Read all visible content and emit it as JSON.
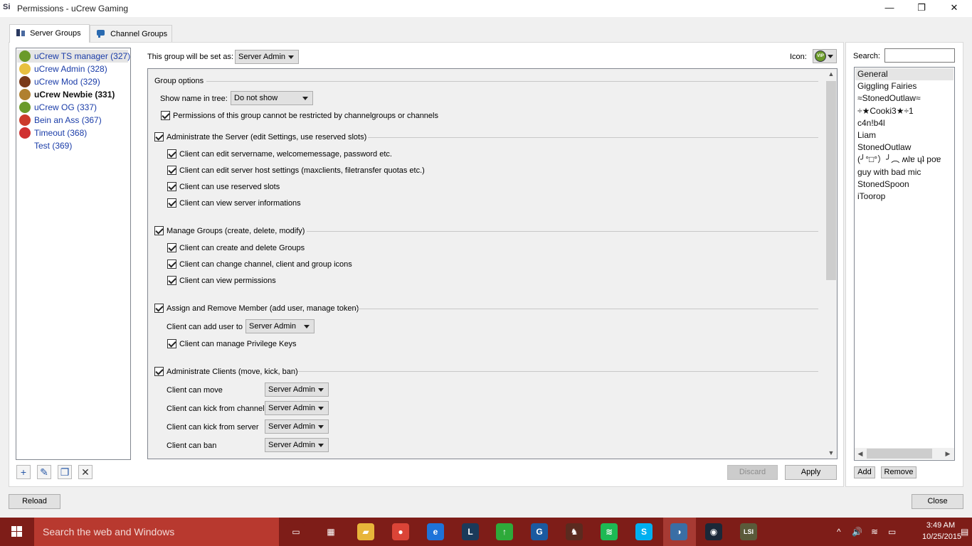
{
  "window": {
    "title": "Permissions - uCrew Gaming",
    "app_icon_text": "Si",
    "minimize_glyph": "—",
    "restore_glyph": "❐",
    "close_glyph": "✕"
  },
  "tabs": [
    {
      "label": "Server Groups",
      "active": true
    },
    {
      "label": "Channel Groups",
      "active": false
    }
  ],
  "groups": [
    {
      "label": "uCrew TS manager (327)",
      "icon": "vip-icon",
      "selected": true,
      "bold": false
    },
    {
      "label": "uCrew Admin (328)",
      "icon": "crown-icon",
      "selected": false,
      "bold": false
    },
    {
      "label": "uCrew Mod (329)",
      "icon": "mod-icon",
      "selected": false,
      "bold": false
    },
    {
      "label": "uCrew Newbie (331)",
      "icon": "newbie-icon",
      "selected": false,
      "bold": true
    },
    {
      "label": "uCrew OG (337)",
      "icon": "vip-icon",
      "selected": false,
      "bold": false
    },
    {
      "label": "Bein an Ass (367)",
      "icon": "ass-icon",
      "selected": false,
      "bold": false
    },
    {
      "label": "Timeout (368)",
      "icon": "timeout-icon",
      "selected": false,
      "bold": false
    },
    {
      "label": "Test (369)",
      "icon": "",
      "selected": false,
      "bold": false
    }
  ],
  "group_toolbar": {
    "add": "+",
    "edit": "✎",
    "copy": "❐",
    "delete": "✕"
  },
  "header": {
    "set_as_label": "This group will be set as:",
    "set_as_value": "Server Admin",
    "icon_label": "Icon:",
    "icon_badge": "VIP"
  },
  "options": {
    "group_options": {
      "title": "Group options",
      "show_name_label": "Show name in tree:",
      "show_name_value": "Do not show",
      "no_restrict_label": "Permissions of this group cannot be restricted by channelgroups or channels"
    },
    "administrate_server": {
      "title": "Administrate the Server (edit Settings, use reserved slots)",
      "items": [
        "Client can edit servername, welcomemessage, password etc.",
        "Client can edit server host settings (maxclients, filetransfer quotas etc.)",
        "Client can use reserved slots",
        "Client can view server informations"
      ]
    },
    "manage_groups": {
      "title": "Manage Groups (create, delete, modify)",
      "items": [
        "Client can create and delete Groups",
        "Client can change channel, client and group icons",
        "Client can view permissions"
      ]
    },
    "assign_member": {
      "title": "Assign and Remove Member (add user, manage token)",
      "add_user_label": "Client can add user to",
      "add_user_value": "Server Admin",
      "privilege_keys": "Client can manage Privilege Keys"
    },
    "administrate_clients": {
      "title": "Administrate Clients (move, kick, ban)",
      "rows": [
        {
          "label": "Client can move",
          "value": "Server Admin"
        },
        {
          "label": "Client can kick from channel",
          "value": "Server Admin"
        },
        {
          "label": "Client can kick from server",
          "value": "Server Admin"
        },
        {
          "label": "Client can ban",
          "value": "Server Admin"
        }
      ]
    }
  },
  "buttons": {
    "discard": "Discard",
    "apply": "Apply",
    "reload": "Reload",
    "close": "Close",
    "add": "Add",
    "remove": "Remove"
  },
  "search": {
    "label": "Search:",
    "value": ""
  },
  "channels": [
    {
      "label": "General",
      "selected": true
    },
    {
      "label": "Giggling Fairies",
      "selected": false
    },
    {
      "label": "≈StonedOutlaw≈",
      "selected": false
    },
    {
      "label": "÷★Cooki3★÷1",
      "selected": false
    },
    {
      "label": "c4n!b4l",
      "selected": false
    },
    {
      "label": "Liam",
      "selected": false
    },
    {
      "label": "StonedOutlaw",
      "selected": false
    },
    {
      "label": "(╯°□°）╯︵ ʍlɐ ɥʇ poɐ",
      "selected": false
    },
    {
      "label": "guy with bad mic",
      "selected": false
    },
    {
      "label": "StonedSpoon",
      "selected": false
    },
    {
      "label": "iToorop",
      "selected": false
    }
  ],
  "scroll": {
    "up": "▲",
    "down": "▼",
    "left": "◀",
    "right": "▶"
  },
  "taskbar": {
    "search_placeholder": "Search the web and Windows",
    "apps": [
      {
        "name": "task-view-icon",
        "glyph": "▭",
        "color": "#7e1d18"
      },
      {
        "name": "store-icon",
        "glyph": "▦",
        "color": "#7e1d18"
      },
      {
        "name": "file-explorer-icon",
        "glyph": "▰",
        "color": "#e8b53a"
      },
      {
        "name": "chrome-icon",
        "glyph": "●",
        "color": "#db4437"
      },
      {
        "name": "edge-icon",
        "glyph": "e",
        "color": "#1e73d9"
      },
      {
        "name": "league-icon",
        "glyph": "L",
        "color": "#1b3a5a"
      },
      {
        "name": "update-icon",
        "glyph": "↑",
        "color": "#2eaa3a"
      },
      {
        "name": "app-g-icon",
        "glyph": "G",
        "color": "#1b5aa0"
      },
      {
        "name": "game-icon",
        "glyph": "♞",
        "color": "#5b2a1f"
      },
      {
        "name": "spotify-icon",
        "glyph": "≋",
        "color": "#1db954"
      },
      {
        "name": "skype-icon",
        "glyph": "S",
        "color": "#00aff0"
      },
      {
        "name": "teamspeak-icon",
        "glyph": "◑",
        "color": "#3a6ea5"
      },
      {
        "name": "steam-icon",
        "glyph": "◉",
        "color": "#1b2838"
      },
      {
        "name": "lsi-icon",
        "glyph": "LSI",
        "color": "#5a5a3a"
      }
    ],
    "tray": {
      "chevron": "^",
      "volume": "🔊",
      "wifi": "≋",
      "battery": "▭",
      "notifications": "▤"
    },
    "time": "3:49 AM",
    "date": "10/25/2015"
  }
}
